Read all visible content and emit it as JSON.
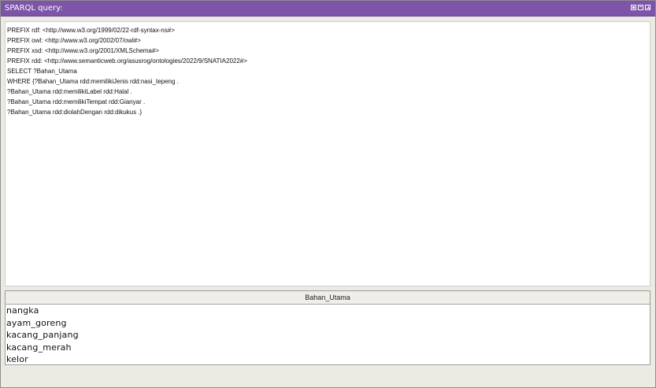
{
  "window": {
    "title": "SPARQL query:"
  },
  "query": {
    "lines": [
      "PREFIX rdf: <http://www.w3.org/1999/02/22-rdf-syntax-ns#>",
      "PREFIX owl: <http://www.w3.org/2002/07/owl#>",
      "PREFIX xsd: <http://www.w3.org/2001/XMLSchema#>",
      "PREFIX rdd: <http://www.semanticweb.org/asusrog/ontologies/2022/9/SNATIA2022#>",
      "SELECT ?Bahan_Utama",
      "WHERE {?Bahan_Utama rdd:memilikiJenis rdd:nasi_tepeng .",
      "?Bahan_Utama rdd:memilikiLabel rdd:Halal .",
      "?Bahan_Utama rdd:memilikiTempat rdd:Gianyar .",
      "?Bahan_Utama rdd:diolahDengan rdd:dikukus .}"
    ]
  },
  "results": {
    "column_header": "Bahan_Utama",
    "rows": [
      "nangka",
      "ayam_goreng",
      "kacang_panjang",
      "kacang_merah",
      "kelor"
    ]
  },
  "icons": {
    "restore": "restore-icon",
    "maximize": "maximize-icon",
    "close": "close-icon"
  },
  "colors": {
    "titlebar": "#7d54a8",
    "background": "#ecebe3",
    "panel": "#ffffff"
  }
}
